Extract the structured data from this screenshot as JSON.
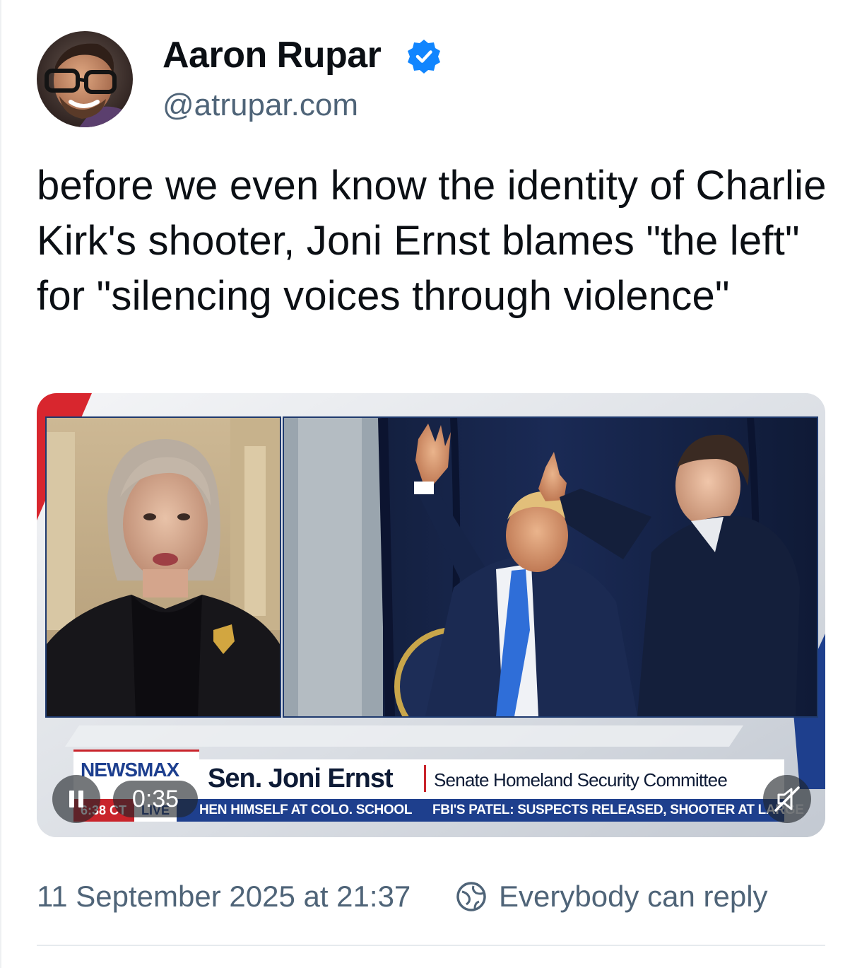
{
  "post": {
    "author": {
      "name": "Aaron Rupar",
      "handle": "@atrupar.com",
      "verified_icon": "verified-badge-icon",
      "verified_color": "#1185fe"
    },
    "text": "before we even know the identity of Charlie Kirk's shooter, Joni Ernst blames \"the left\" for \"silencing voices through violence\"",
    "video": {
      "elapsed": "0:35",
      "pause_icon": "pause-icon",
      "mute_icon": "muted-speaker-icon",
      "broadcast": {
        "network": "NEWSMAX",
        "name": "Sen. Joni Ernst",
        "role": "Senate Homeland Security Committee",
        "time": "6:38 CT",
        "live": "LIVE",
        "ticker_1": "HEN HIMSELF AT COLO. SCHOOL",
        "ticker_2": "FBI'S PATEL: SUSPECTS RELEASED, SHOOTER AT LARGE",
        "brand_color": "#1e3f8d",
        "accent_color": "#c9242b"
      }
    },
    "footer": {
      "timestamp": "11 September 2025 at 21:37",
      "reply_setting": "Everybody can reply",
      "reply_icon": "globe-reply-icon"
    },
    "colors": {
      "text_primary": "#0b0f14",
      "text_secondary": "#4f6478"
    }
  }
}
